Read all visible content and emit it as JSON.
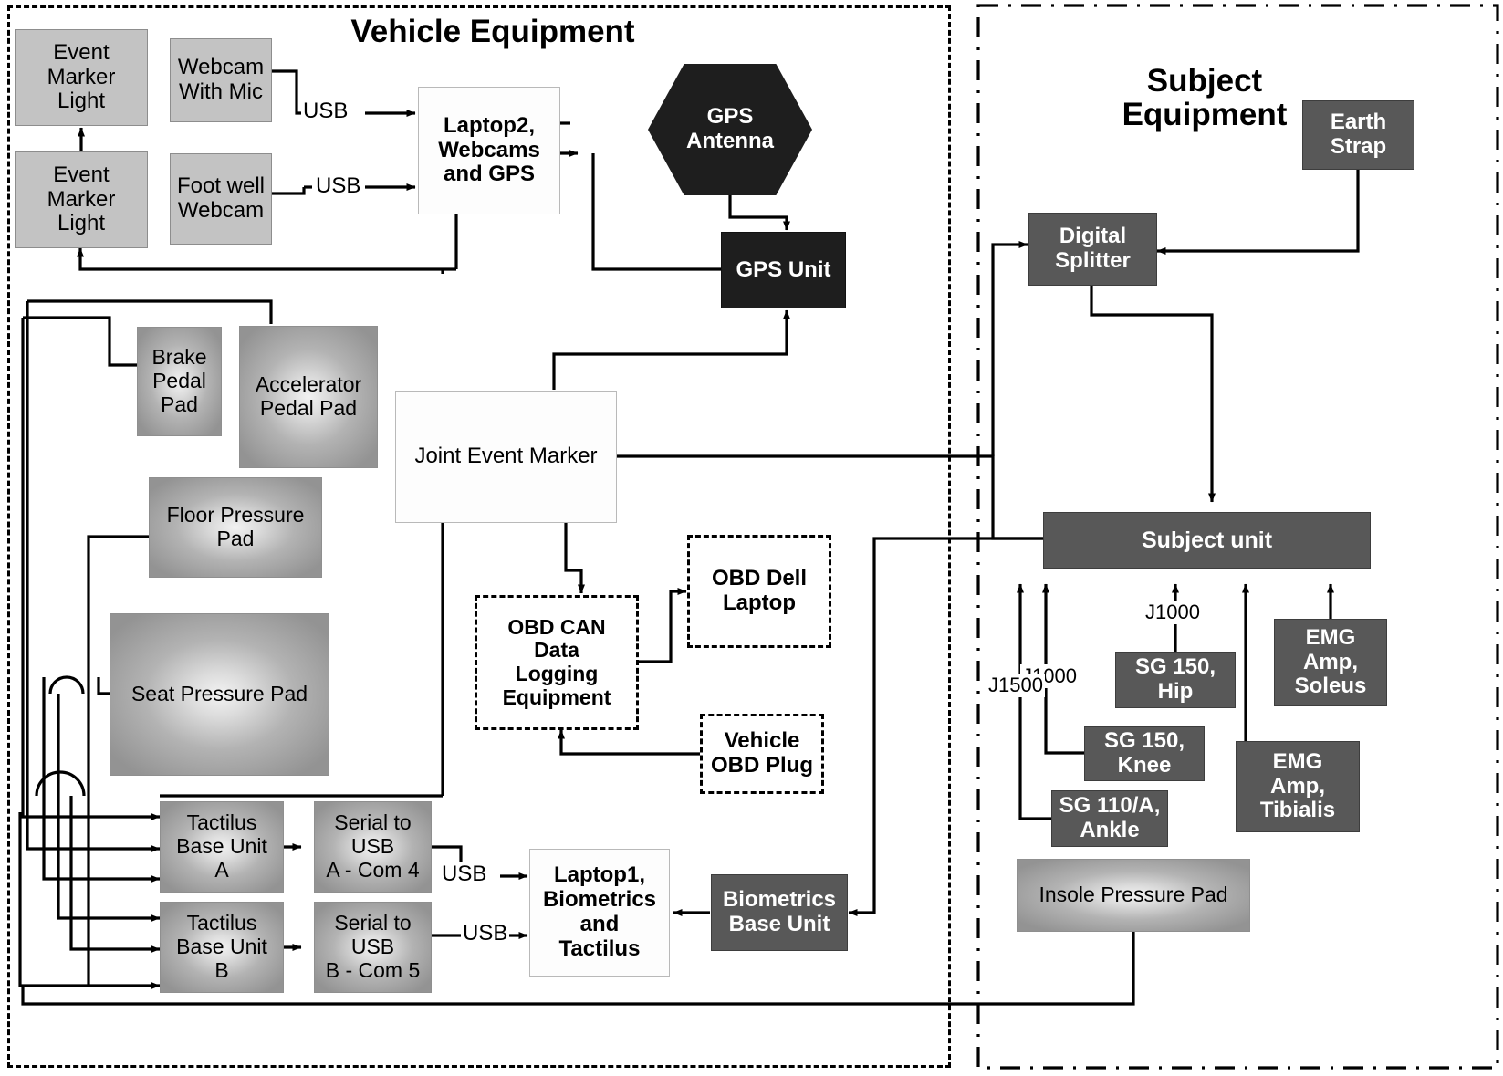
{
  "panels": {
    "vehicle": {
      "title": "Vehicle Equipment"
    },
    "subject": {
      "title_line1": "Subject",
      "title_line2": "Equipment"
    }
  },
  "nodes": {
    "event_marker_light_top": "Event\nMarker\nLight",
    "event_marker_light_bottom": "Event\nMarker\nLight",
    "webcam_with_mic": "Webcam\nWith Mic",
    "foot_well_webcam": "Foot well\nWebcam",
    "laptop2": "Laptop2,\nWebcams\nand GPS",
    "gps_antenna": "GPS\nAntenna",
    "gps_unit": "GPS Unit",
    "brake_pedal_pad": "Brake\nPedal\nPad",
    "accelerator_pedal_pad": "Accelerator\nPedal Pad",
    "floor_pressure_pad": "Floor Pressure\nPad",
    "seat_pressure_pad": "Seat Pressure Pad",
    "joint_event_marker": "Joint Event Marker",
    "obd_can": "OBD CAN\nData\nLogging\nEquipment",
    "obd_dell_laptop": "OBD Dell\nLaptop",
    "vehicle_obd_plug": "Vehicle\nOBD Plug",
    "tactilus_a": "Tactilus\nBase Unit\nA",
    "tactilus_b": "Tactilus\nBase Unit\nB",
    "serial_usb_a": "Serial to\nUSB\nA - Com 4",
    "serial_usb_b": "Serial to\nUSB\nB - Com 5",
    "laptop1": "Laptop1,\nBiometrics\nand\nTactilus",
    "biometrics_base_unit": "Biometrics\nBase Unit",
    "earth_strap": "Earth\nStrap",
    "digital_splitter": "Digital\nSplitter",
    "subject_unit": "Subject unit",
    "sg150_hip": "SG 150,\nHip",
    "sg150_knee": "SG 150,\nKnee",
    "sg110a_ankle": "SG 110/A,\nAnkle",
    "emg_amp_soleus": "EMG\nAmp,\nSoleus",
    "emg_amp_tibialis": "EMG\nAmp,\nTibialis",
    "insole_pressure_pad": "Insole Pressure Pad"
  },
  "edge_labels": {
    "usb_webcam_mic": "USB",
    "usb_foot_well": "USB",
    "usb_serial_a": "USB",
    "usb_serial_b": "USB",
    "j1000_hip": "J1000",
    "j1000_knee": "J1000",
    "j1500_ankle": "J1500"
  },
  "colors": {
    "dark_box": "#585858",
    "black_box": "#1e1e1e",
    "flat_gray_box": "#c3c3c3",
    "wire": "#000000",
    "white_box": "#fdfdfd"
  }
}
